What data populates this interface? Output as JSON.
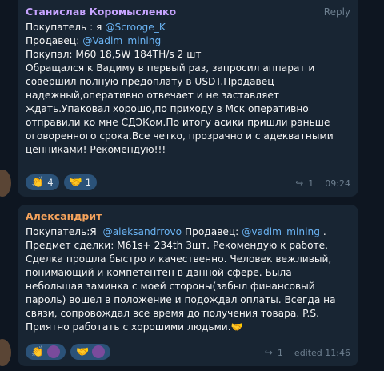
{
  "messages": [
    {
      "author": "Станислав Коромысленко",
      "author_color": "#c7a4ff",
      "reply_label": "Reply",
      "lines": {
        "l1a": "Покупатель : я ",
        "l1b": "@Scrooge_K",
        "l2a": "Продавец: ",
        "l2b": "@Vadim_mining",
        "body": "Покупал: М60 18,5W 184TH/s 2 шт\nОбращался к Вадиму в первый раз, запросил аппарат и совершил полную предоплату в USDT.Продавец надежный,оперативно отвечает и не заставляет ждать.Упаковал хорошо,по приходу в Мск оперативно отправили ко мне СДЭКом.По итогу асики пришли раньше оговоренного срока.Все четко, прозрачно и с адекватными ценниками! Рекомендую!!!"
      },
      "reactions": [
        {
          "emoji": "👏",
          "count": "4"
        },
        {
          "emoji": "🤝",
          "count": "1"
        }
      ],
      "forwards": "1",
      "time": "09:24"
    },
    {
      "author": "Александрит",
      "author_color": "#f5a35c",
      "lines": {
        "l1a": "Покупатель:Я  ",
        "l1b": "@aleksandrrovo",
        "l1c": " Продавец: ",
        "l1d": "@vadim_mining",
        "l1e": " .",
        "body": "Предмет сделки: М61s+ 234th 3шт. Рекомендую к работе. Сделка прошла быстро и качественно. Человек вежливый, понимающий и компетентен в данной сфере. Была небольшая заминка с моей стороны(забыл финансовый пароль) вошел в положение и подождал оплаты. Всегда на связи, сопровождал все время до получения товара. P.S.  Приятно работать с хорошими людьми.🤝"
      },
      "reactions": [
        {
          "emoji": "👏"
        },
        {
          "emoji": "🤝"
        }
      ],
      "forwards": "1",
      "edited_time": "edited 11:46"
    }
  ]
}
